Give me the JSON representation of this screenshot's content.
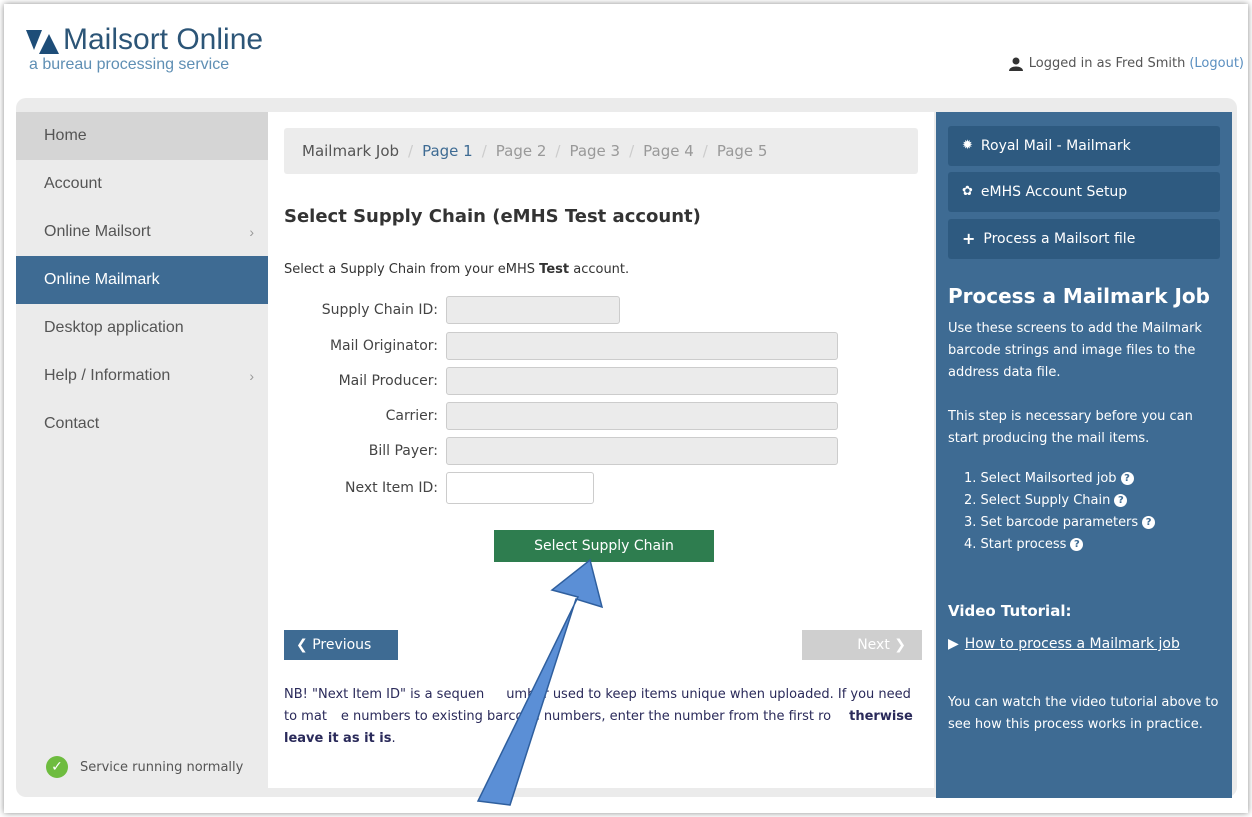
{
  "header": {
    "title": "Mailsort Online",
    "subtitle": "a bureau processing service",
    "login_text": "Logged in as Fred Smith",
    "logout_label": "(Logout)"
  },
  "sidebar": {
    "items": [
      {
        "label": "Home"
      },
      {
        "label": "Account"
      },
      {
        "label": "Online Mailsort",
        "chevron": "›"
      },
      {
        "label": "Online Mailmark"
      },
      {
        "label": "Desktop application"
      },
      {
        "label": "Help / Information",
        "chevron": "›"
      },
      {
        "label": "Contact"
      }
    ],
    "status": "Service running normally"
  },
  "breadcrumb": {
    "items": [
      "Mailmark Job",
      "Page 1",
      "Page 2",
      "Page 3",
      "Page 4",
      "Page 5"
    ],
    "separator": "/"
  },
  "main": {
    "title": "Select Supply Chain (eMHS Test account)",
    "intro_pre": "Select a Supply Chain from your eMHS ",
    "intro_bold": "Test",
    "intro_post": " account.",
    "fields": [
      {
        "label": "Supply Chain ID:",
        "value": ""
      },
      {
        "label": "Mail Originator:",
        "value": ""
      },
      {
        "label": "Mail Producer:",
        "value": ""
      },
      {
        "label": "Carrier:",
        "value": ""
      },
      {
        "label": "Bill Payer:",
        "value": ""
      },
      {
        "label": "Next Item ID:",
        "value": ""
      }
    ],
    "submit_label": "Select Supply Chain",
    "prev_label": "Previous",
    "next_label": "Next",
    "note_pre": "NB! \"Next Item ID\" is a sequen",
    "note_mid1": "umber used to keep items unique when uploaded. If you need to mat",
    "note_mid2": "e numbers to existing barcode numbers, enter the number from the first ro",
    "note_bold": "therwise leave it as it is",
    "note_end": "."
  },
  "right_panel": {
    "buttons": [
      {
        "label": "Royal Mail - Mailmark",
        "icon": "gear-icon"
      },
      {
        "label": "eMHS Account Setup",
        "icon": "cog-icon"
      },
      {
        "label": "Process a Mailsort file",
        "icon": "plus-icon"
      }
    ],
    "title": "Process a Mailmark Job",
    "desc1": "Use these screens to add the Mailmark barcode strings and image files to the address data file.",
    "desc2": "This step is necessary before you can start producing the mail items.",
    "steps": [
      "1. Select Mailsorted job",
      "2. Select Supply Chain",
      "3. Set barcode parameters",
      "4. Start process"
    ],
    "video_title": "Video Tutorial:",
    "video_link": "How to process a Mailmark job",
    "video_desc": "You can watch the video tutorial above to see how this process works in practice."
  },
  "colors": {
    "brand_blue": "#3e6b93",
    "button_green": "#2e7d4f",
    "status_green": "#6ebc3f"
  }
}
